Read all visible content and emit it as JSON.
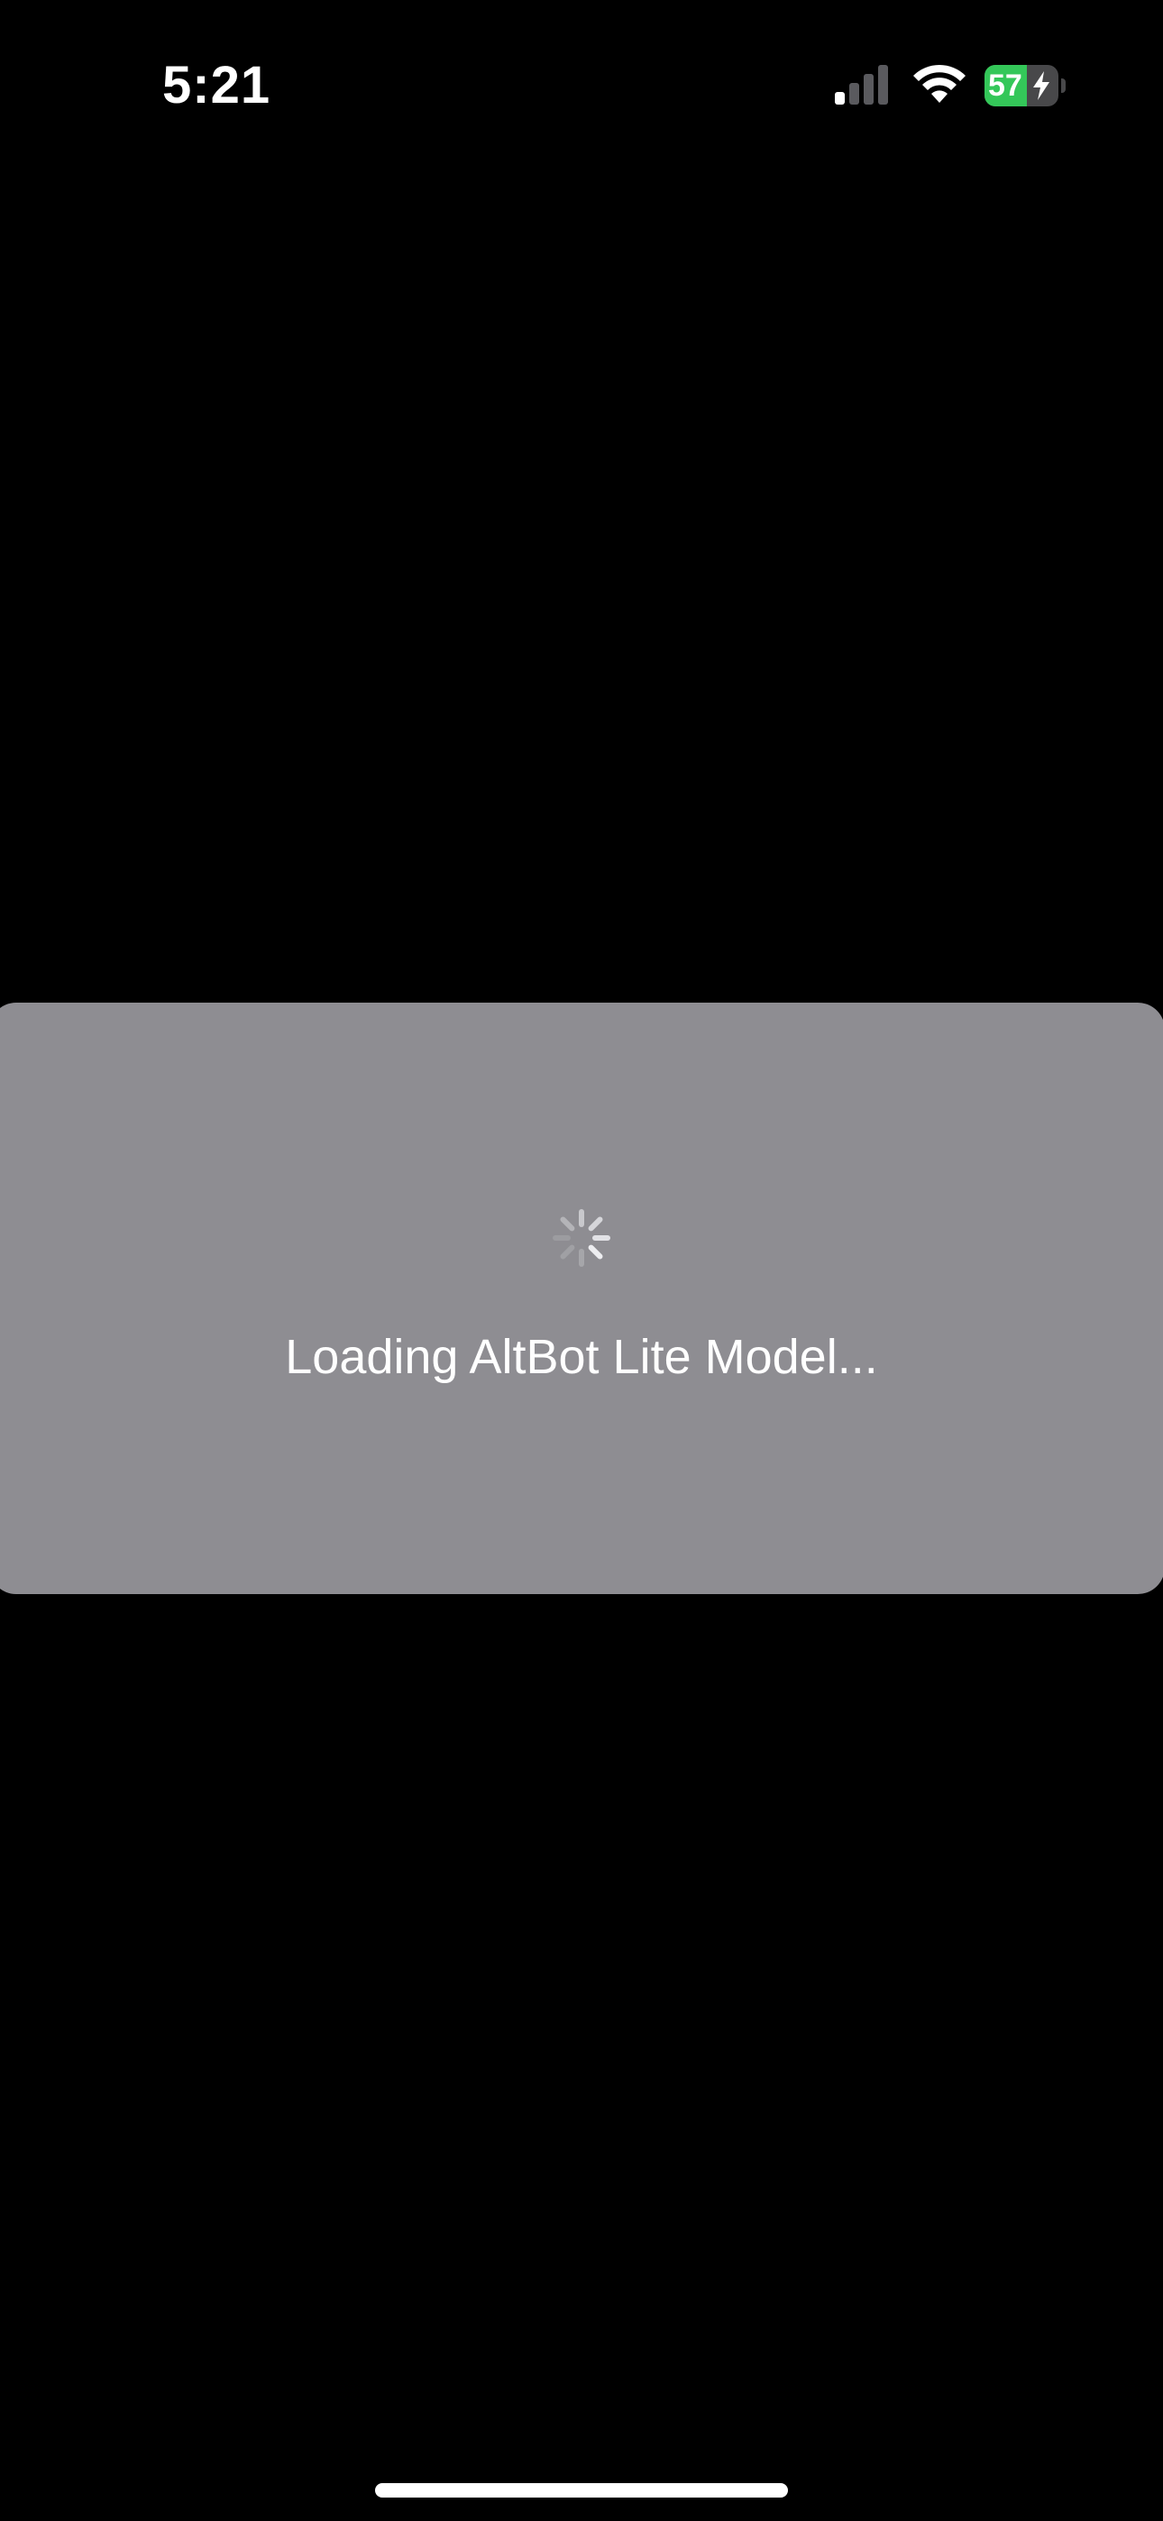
{
  "status_bar": {
    "time": "5:21",
    "signal_icon": "cellular-signal-icon",
    "signal_bars_active": 1,
    "signal_bars_total": 4,
    "wifi_icon": "wifi-icon",
    "battery_percent": "57",
    "battery_level": 0.57,
    "battery_charging_icon": "bolt-icon",
    "battery_color": "#34c759"
  },
  "loading": {
    "spinner_icon": "activity-spinner-icon",
    "message": "Loading AltBot Lite Model..."
  },
  "colors": {
    "background": "#000000",
    "card": "#8e8d92",
    "text": "#ffffff"
  }
}
